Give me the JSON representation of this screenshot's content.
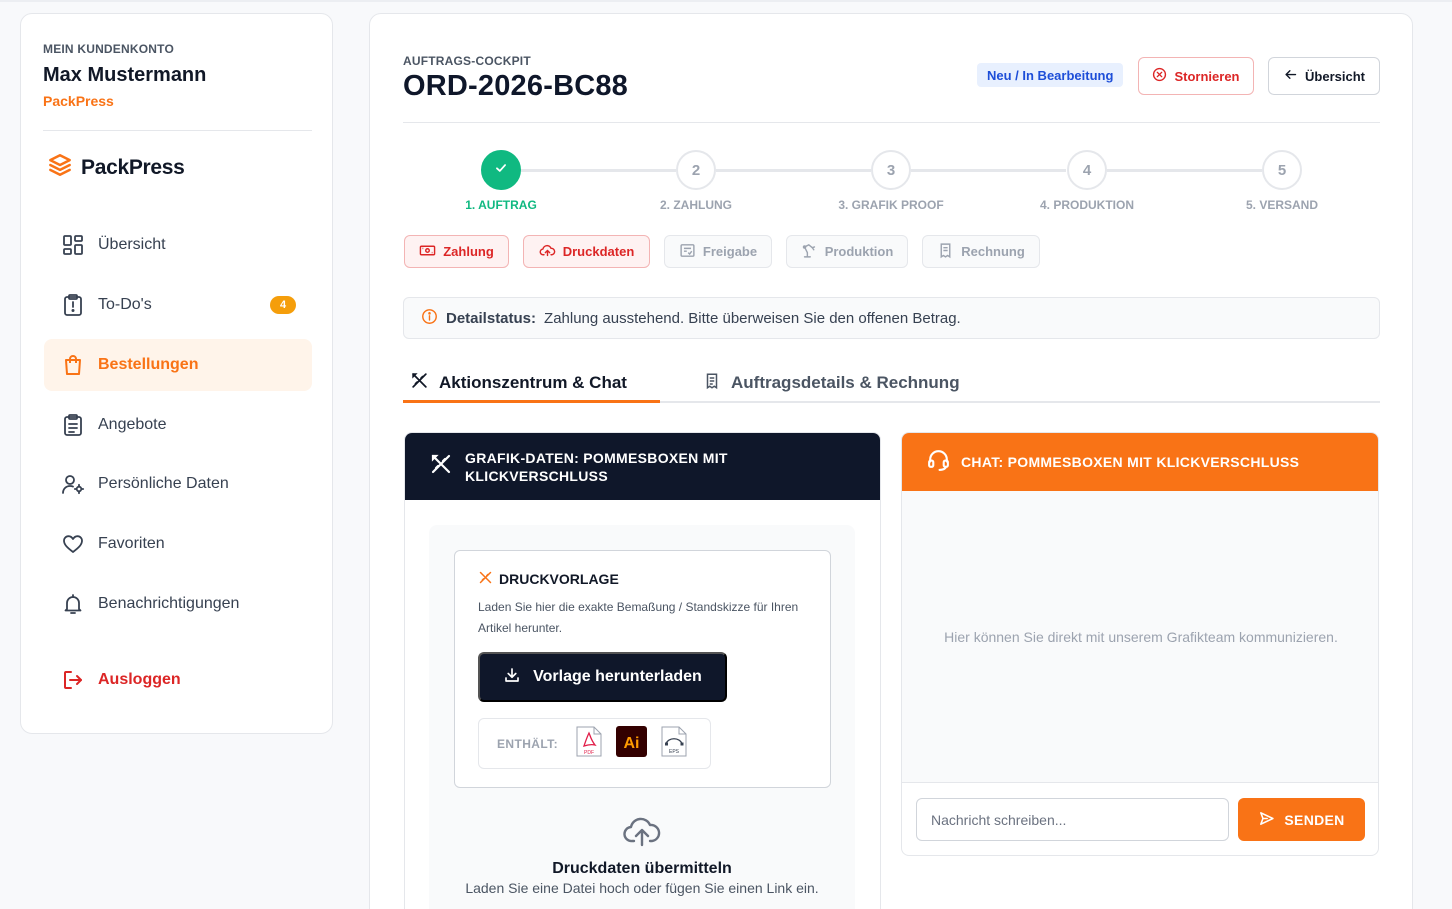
{
  "sidebar": {
    "kicker": "MEIN KUNDENKONTO",
    "user_name": "Max Mustermann",
    "company": "PackPress",
    "logo_text": "PackPress",
    "items": [
      {
        "label": "Übersicht",
        "icon": "dashboard-icon"
      },
      {
        "label": "To-Do's",
        "icon": "clipboard-alert-icon",
        "badge": "4"
      },
      {
        "label": "Bestellungen",
        "icon": "shopping-bag-icon",
        "active": true
      },
      {
        "label": "Angebote",
        "icon": "clipboard-list-icon"
      },
      {
        "label": "Persönliche Daten",
        "icon": "user-settings-icon"
      },
      {
        "label": "Favoriten",
        "icon": "heart-icon"
      },
      {
        "label": "Benachrichtigungen",
        "icon": "bell-icon"
      }
    ],
    "logout_label": "Ausloggen"
  },
  "header": {
    "kicker": "AUFTRAGS-COCKPIT",
    "order_id": "ORD-2026-BC88",
    "status": "Neu / In Bearbeitung",
    "cancel_label": "Stornieren",
    "back_label": "Übersicht"
  },
  "stepper": {
    "steps": [
      {
        "number": "1",
        "label": "1. AUFTRAG",
        "done": true
      },
      {
        "number": "2",
        "label": "2. ZAHLUNG",
        "done": false
      },
      {
        "number": "3",
        "label": "3. GRAFIK PROOF",
        "done": false
      },
      {
        "number": "4",
        "label": "4. PRODUKTION",
        "done": false
      },
      {
        "number": "5",
        "label": "5. VERSAND",
        "done": false
      }
    ]
  },
  "chips": [
    {
      "label": "Zahlung",
      "state": "alert"
    },
    {
      "label": "Druckdaten",
      "state": "alert"
    },
    {
      "label": "Freigabe",
      "state": "inactive"
    },
    {
      "label": "Produktion",
      "state": "inactive"
    },
    {
      "label": "Rechnung",
      "state": "inactive"
    }
  ],
  "detail_status": {
    "label": "Detailstatus:",
    "text": "Zahlung ausstehend. Bitte überweisen Sie den offenen Betrag."
  },
  "tabs": [
    {
      "label": "Aktionszentrum & Chat",
      "active": true
    },
    {
      "label": "Auftragsdetails & Rechnung",
      "active": false
    }
  ],
  "grafik_card": {
    "title": "GRAFIK-DATEN: POMMESBOXEN MIT KLICKVERSCHLUSS",
    "template": {
      "title": "DRUCKVORLAGE",
      "description": "Laden Sie hier die exakte Bemaßung / Standskizze für Ihren Artikel herunter.",
      "download_label": "Vorlage herunterladen",
      "contains_label": "ENTHÄLT:",
      "formats": [
        "PDF",
        "Ai",
        "EPS"
      ]
    },
    "upload": {
      "title": "Druckdaten übermitteln",
      "description": "Laden Sie eine Datei hoch oder fügen Sie einen Link ein."
    }
  },
  "chat_card": {
    "title": "CHAT: POMMESBOXEN MIT KLICKVERSCHLUSS",
    "empty_text": "Hier können Sie direkt mit unserem Grafikteam kommunizieren.",
    "input_placeholder": "Nachricht schreiben...",
    "send_label": "SENDEN"
  },
  "colors": {
    "accent": "#f97316",
    "navy": "#0f172a",
    "success": "#10b981",
    "danger": "#dc2626",
    "status_blue": "#1d4ed8"
  }
}
